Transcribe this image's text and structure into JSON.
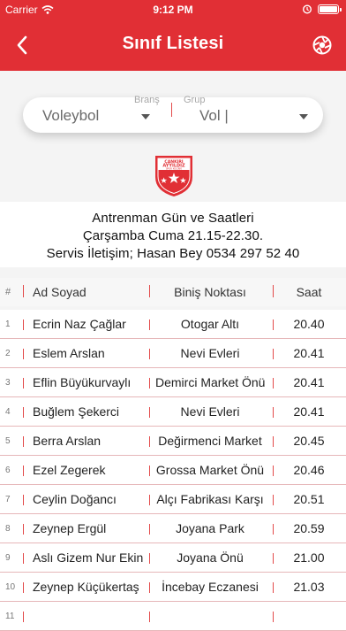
{
  "status": {
    "carrier": "Carrier",
    "time": "9:12 PM"
  },
  "nav": {
    "title": "Sınıf Listesi"
  },
  "filter": {
    "brans_label": "Branş",
    "brans_value": "Voleybol",
    "grup_label": "Grup",
    "grup_value": "Vol |"
  },
  "logo": {
    "text_top": "ÇANKIRI",
    "text_mid": "AYYILDIZ",
    "text_bottom": "SPOR KULÜBÜ"
  },
  "info": {
    "line1": "Antrenman Gün ve Saatleri",
    "line2": "Çarşamba Cuma 21.15-22.30.",
    "line3": "Servis İletişim; Hasan Bey 0534 297 52 40"
  },
  "table": {
    "headers": {
      "no": "#",
      "name": "Ad Soyad",
      "stop": "Biniş Noktası",
      "time": "Saat"
    },
    "rows": [
      {
        "no": "1",
        "name": "Ecrin Naz Çağlar",
        "stop": "Otogar Altı",
        "time": "20.40"
      },
      {
        "no": "2",
        "name": "Eslem Arslan",
        "stop": "Nevi Evleri",
        "time": "20.41"
      },
      {
        "no": "3",
        "name": "Eflin Büyükurvaylı",
        "stop": "Demirci Market Önü",
        "time": "20.41"
      },
      {
        "no": "4",
        "name": "Buğlem Şekerci",
        "stop": "Nevi Evleri",
        "time": "20.41"
      },
      {
        "no": "5",
        "name": "Berra Arslan",
        "stop": "Değirmenci Market",
        "time": "20.45"
      },
      {
        "no": "6",
        "name": "Ezel Zegerek",
        "stop": "Grossa Market Önü",
        "time": "20.46"
      },
      {
        "no": "7",
        "name": "Ceylin Doğancı",
        "stop": "Alçı Fabrikası Karşı",
        "time": "20.51"
      },
      {
        "no": "8",
        "name": "Zeynep Ergül",
        "stop": "Joyana Park",
        "time": "20.59"
      },
      {
        "no": "9",
        "name": "Aslı Gizem Nur Ekin",
        "stop": "Joyana Önü",
        "time": "21.00"
      },
      {
        "no": "10",
        "name": "Zeynep Küçükertaş",
        "stop": "İncebay Eczanesi",
        "time": "21.03"
      },
      {
        "no": "11",
        "name": "",
        "stop": "",
        "time": ""
      }
    ]
  },
  "colors": {
    "accent": "#e12f35",
    "separator": "#e34a4a"
  }
}
